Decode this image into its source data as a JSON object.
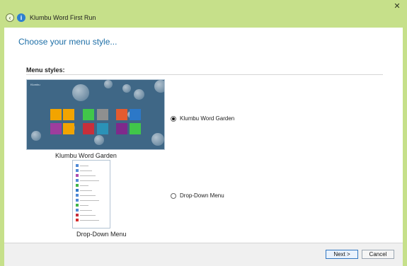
{
  "window": {
    "title": "Klumbu Word First Run",
    "back_glyph": "‹",
    "app_icon": "info-icon",
    "close_glyph": "✕"
  },
  "page": {
    "heading": "Choose your menu style...",
    "section_label": "Menu styles:"
  },
  "options": [
    {
      "label": "Klumbu Word Garden",
      "caption": "Klumbu Word Garden",
      "selected": true
    },
    {
      "label": "Drop-Down Menu",
      "caption": "Drop-Down Menu",
      "selected": false
    }
  ],
  "garden_tile_colors": [
    "#f2a400",
    "#f2a400",
    "#41c64a",
    "#8f8f8f",
    "#e45b2f",
    "#2c78c8",
    "#9e3d9d",
    "#f2a400",
    "#c82f3b",
    "#2b92b7",
    "#7f2a8c",
    "#41c64a"
  ],
  "dropdown_icon_colors": [
    "#4f89d6",
    "#4f89d6",
    "#ad4cae",
    "#4f89d6",
    "#41b54a",
    "#3078c8",
    "#4f89d6",
    "#4f89d6",
    "#41b54a",
    "#4f89d6",
    "#c82f3b",
    "#d52f2f"
  ],
  "footer": {
    "next_label": "Next >",
    "cancel_label": "Cancel"
  }
}
